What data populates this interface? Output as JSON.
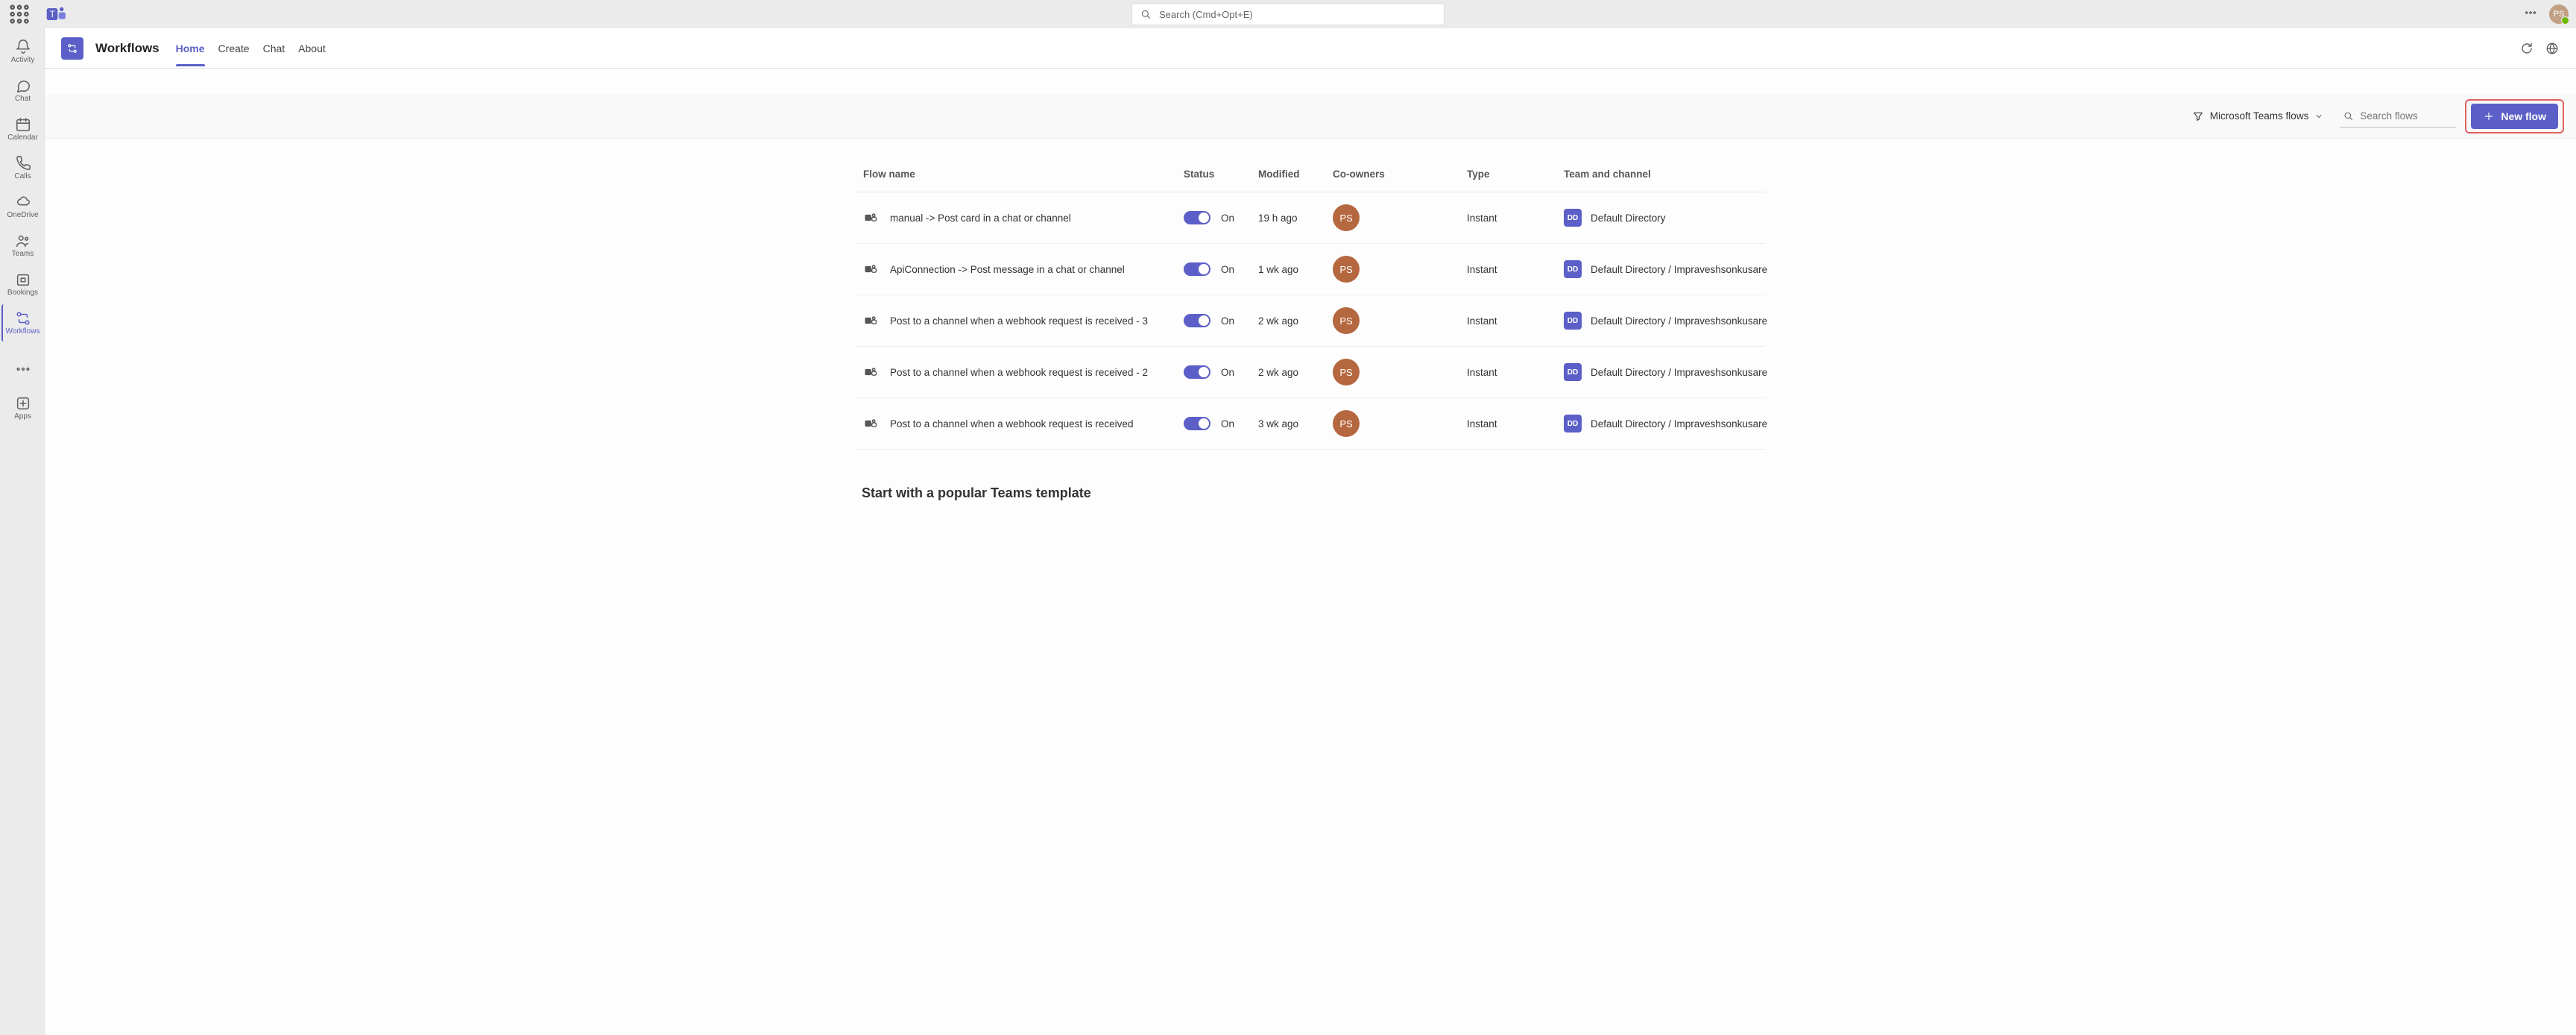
{
  "titlebar": {
    "search_placeholder": "Search (Cmd+Opt+E)",
    "user_initials": "PS"
  },
  "rail": {
    "items": [
      {
        "label": "Activity"
      },
      {
        "label": "Chat"
      },
      {
        "label": "Calendar"
      },
      {
        "label": "Calls"
      },
      {
        "label": "OneDrive"
      },
      {
        "label": "Teams"
      },
      {
        "label": "Bookings"
      },
      {
        "label": "Workflows"
      }
    ],
    "apps_label": "Apps"
  },
  "header": {
    "app_title": "Workflows",
    "tabs": [
      {
        "label": "Home"
      },
      {
        "label": "Create"
      },
      {
        "label": "Chat"
      },
      {
        "label": "About"
      }
    ]
  },
  "toolbar": {
    "filter_label": "Microsoft Teams flows",
    "search_placeholder": "Search flows",
    "new_flow_label": "New flow"
  },
  "columns": {
    "c0": "Flow name",
    "c1": "Status",
    "c2": "Modified",
    "c3": "Co-owners",
    "c4": "Type",
    "c5": "Team and channel"
  },
  "rows": [
    {
      "name": "manual -> Post card in a chat or channel",
      "status": "On",
      "modified": "19 h ago",
      "owner": "PS",
      "type": "Instant",
      "team_badge": "DD",
      "team": "Default Directory"
    },
    {
      "name": "ApiConnection -> Post message in a chat or channel",
      "status": "On",
      "modified": "1 wk ago",
      "owner": "PS",
      "type": "Instant",
      "team_badge": "DD",
      "team": "Default Directory / Impraveshsonkusare"
    },
    {
      "name": "Post to a channel when a webhook request is received - 3",
      "status": "On",
      "modified": "2 wk ago",
      "owner": "PS",
      "type": "Instant",
      "team_badge": "DD",
      "team": "Default Directory / Impraveshsonkusare"
    },
    {
      "name": "Post to a channel when a webhook request is received - 2",
      "status": "On",
      "modified": "2 wk ago",
      "owner": "PS",
      "type": "Instant",
      "team_badge": "DD",
      "team": "Default Directory / Impraveshsonkusare"
    },
    {
      "name": "Post to a channel when a webhook request is received",
      "status": "On",
      "modified": "3 wk ago",
      "owner": "PS",
      "type": "Instant",
      "team_badge": "DD",
      "team": "Default Directory / Impraveshsonkusare"
    }
  ],
  "templates_heading": "Start with a popular Teams template"
}
